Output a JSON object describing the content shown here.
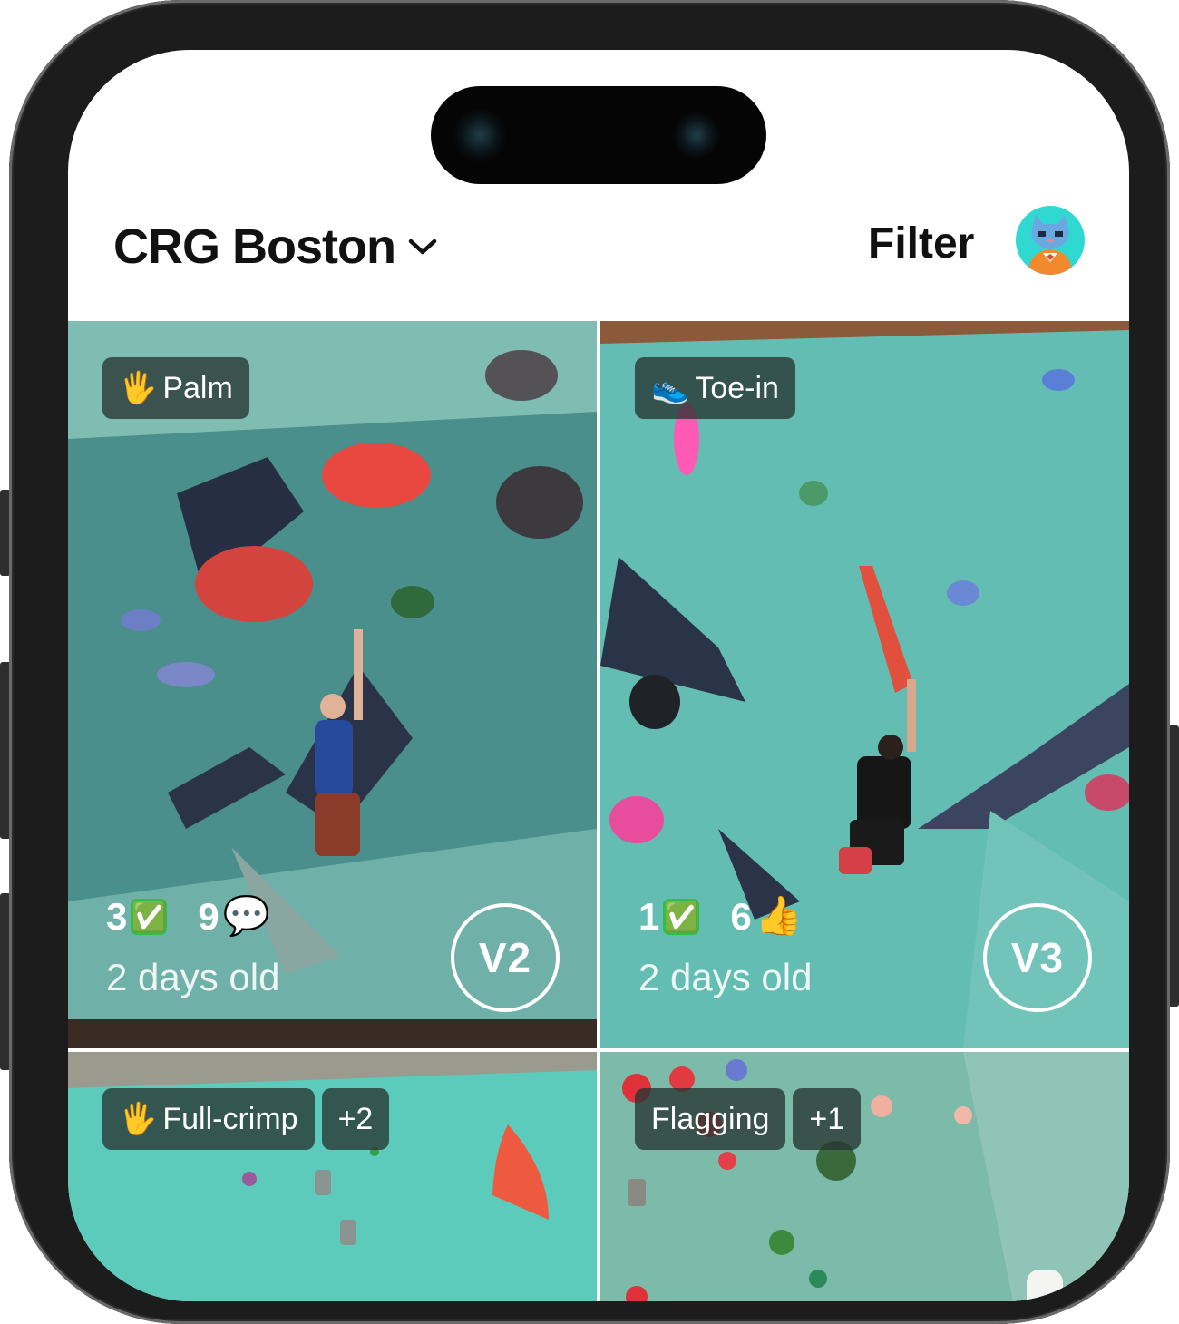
{
  "header": {
    "gym_name": "CRG Boston",
    "filter_label": "Filter"
  },
  "colors": {
    "wall_teal": "#5fb8ae",
    "tag_bg": "#2b3634",
    "check_green": "#2fbf4a"
  },
  "routes": [
    {
      "tags": [
        {
          "icon": "🖐",
          "label": "Palm"
        }
      ],
      "sends": "3",
      "send_icon": "✅",
      "reactions": "9",
      "reaction_icon": "💬",
      "age": "2 days old",
      "grade": "V2"
    },
    {
      "tags": [
        {
          "icon": "👟",
          "label": "Toe-in"
        }
      ],
      "sends": "1",
      "send_icon": "✅",
      "reactions": "6",
      "reaction_icon": "👍",
      "age": "2 days old",
      "grade": "V3"
    },
    {
      "tags": [
        {
          "icon": "🖐",
          "label": "Full-crimp"
        },
        {
          "icon": "",
          "label": "+2"
        }
      ]
    },
    {
      "tags": [
        {
          "icon": "",
          "label": "Flagging"
        },
        {
          "icon": "",
          "label": "+1"
        }
      ]
    }
  ]
}
